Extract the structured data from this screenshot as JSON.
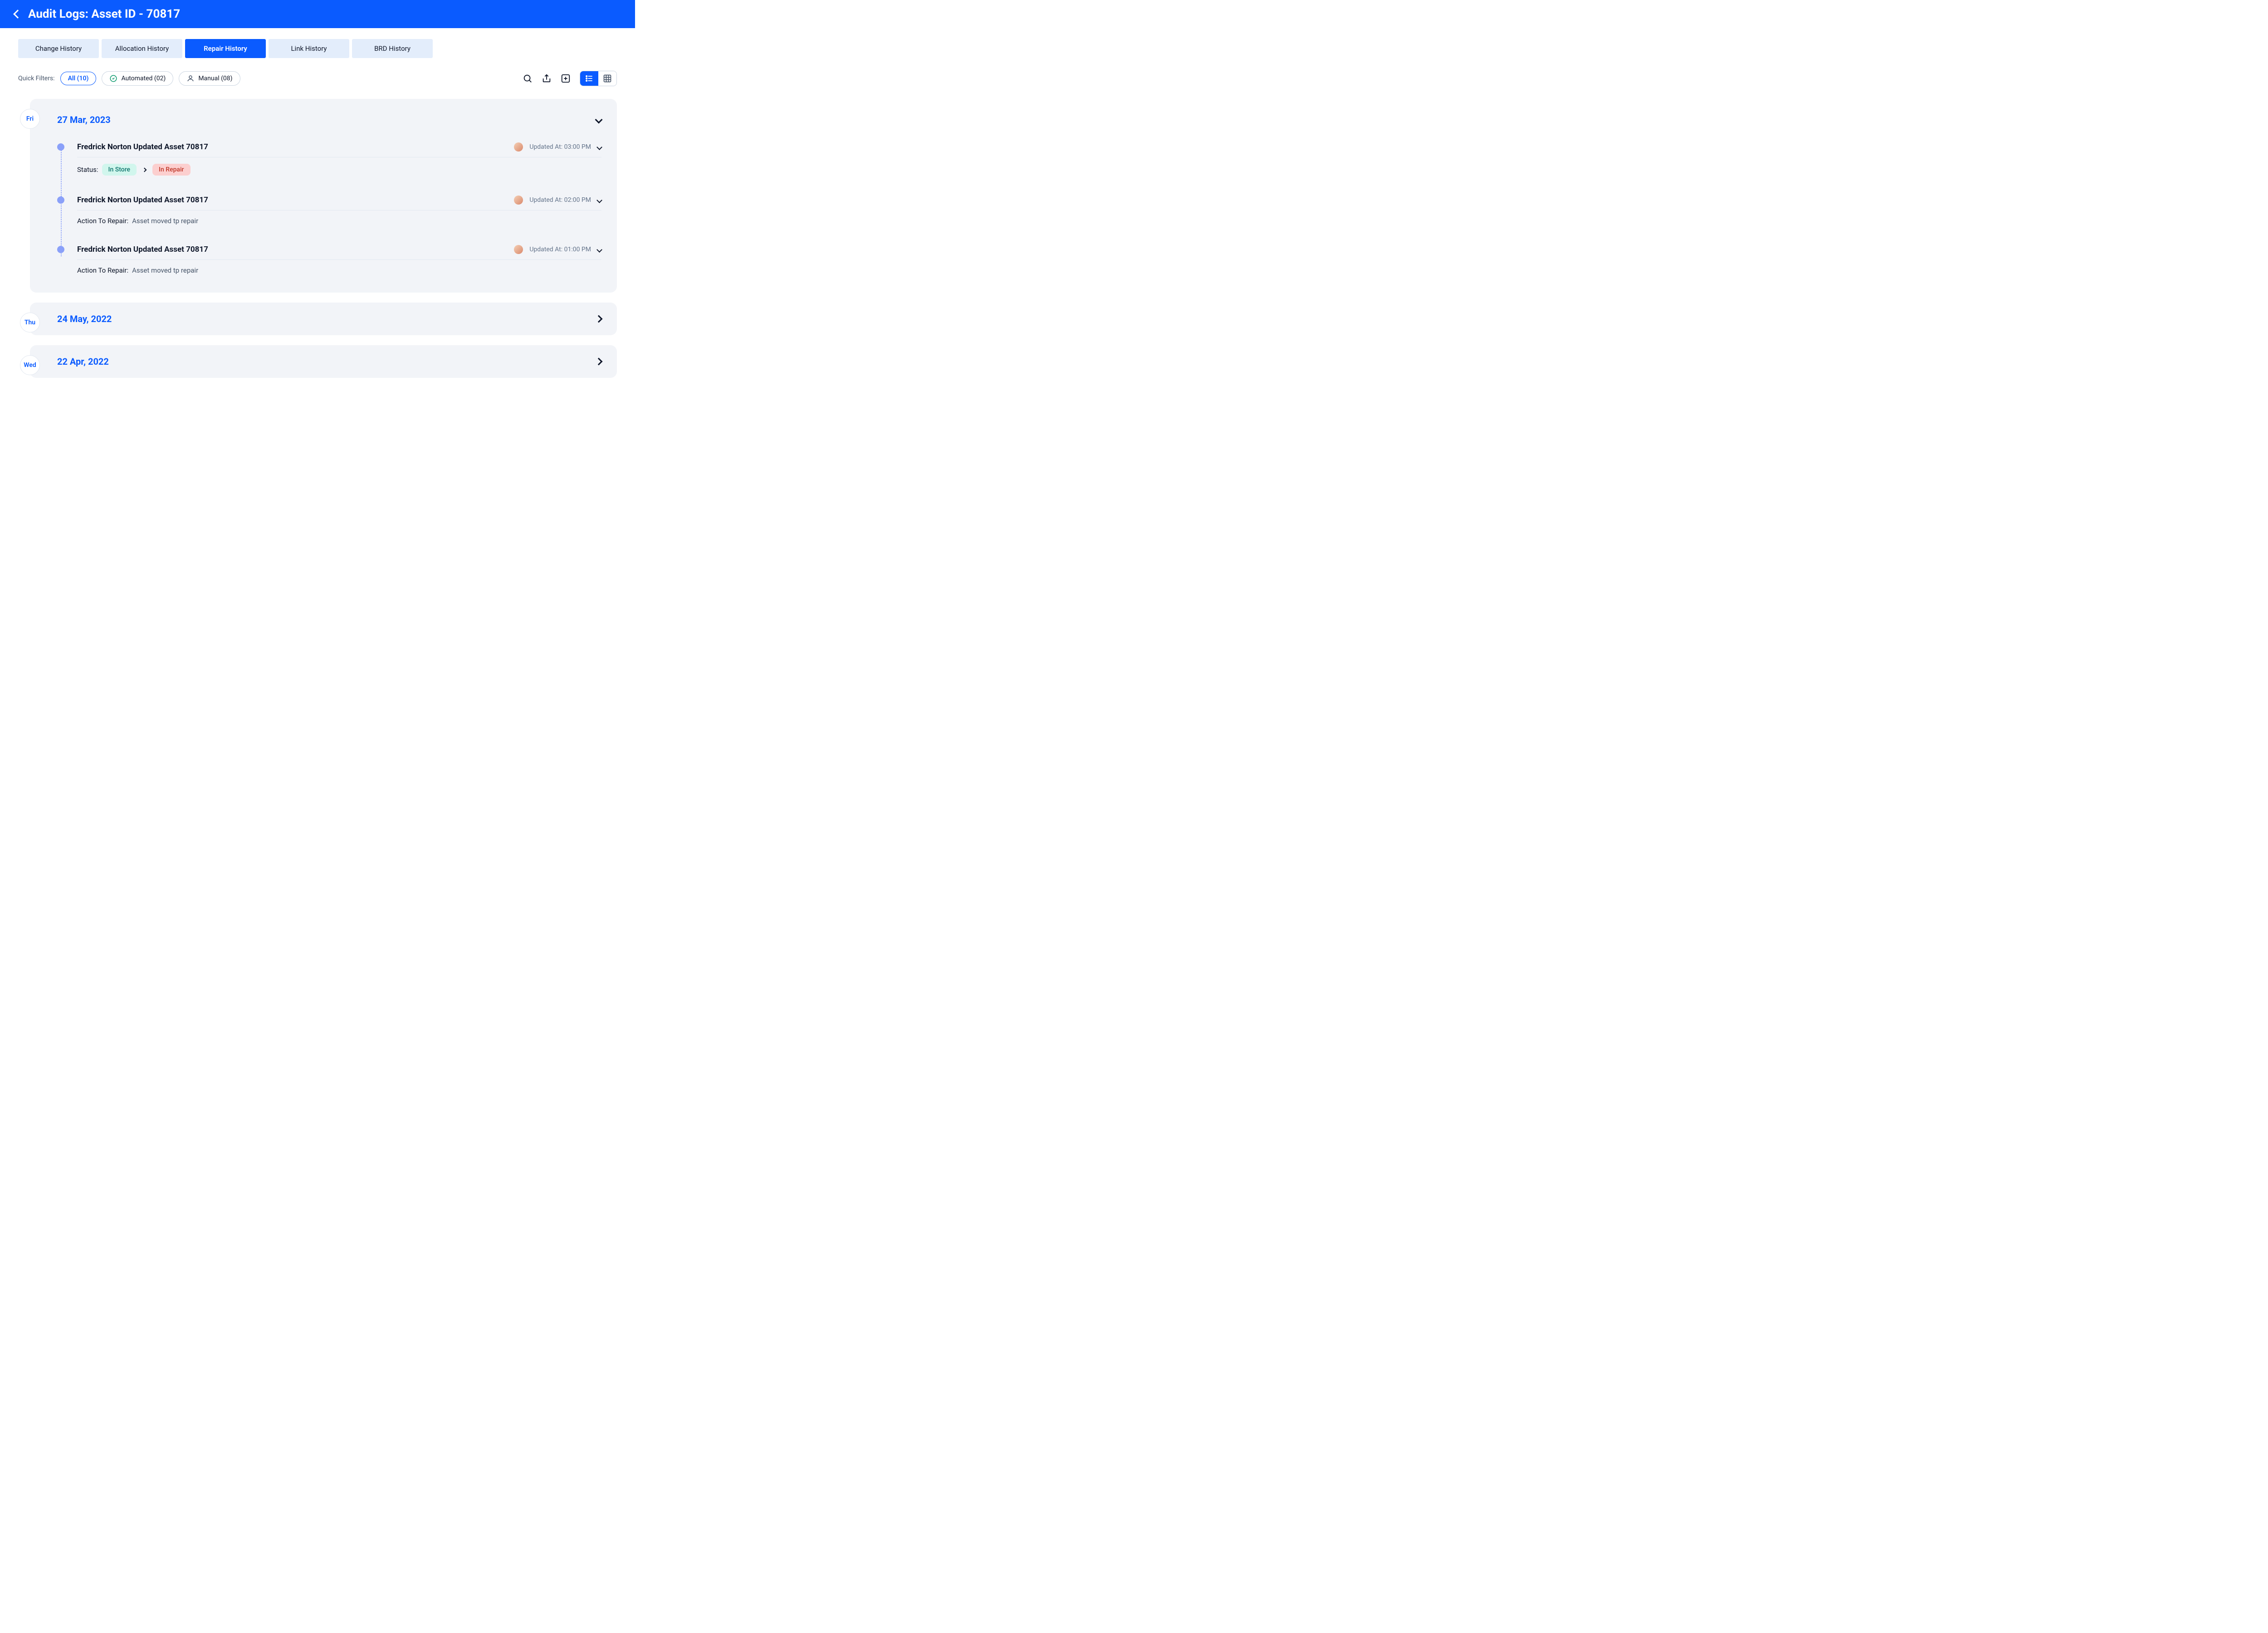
{
  "header": {
    "title": "Audit Logs:  Asset ID - 70817"
  },
  "tabs": [
    {
      "label": "Change History"
    },
    {
      "label": "Allocation History"
    },
    {
      "label": "Repair History"
    },
    {
      "label": "Link History"
    },
    {
      "label": "BRD History"
    }
  ],
  "filters": {
    "label": "Quick Filters:",
    "pills": [
      {
        "label": "All (10)"
      },
      {
        "label": "Automated (02)"
      },
      {
        "label": "Manual (08)"
      }
    ]
  },
  "days": [
    {
      "badge": "Fri",
      "date": "27 Mar, 2023",
      "events": [
        {
          "title": "Fredrick Norton Updated Asset 70817",
          "meta": "Updated At: 03:00 PM",
          "status_label": "Status:",
          "from_chip": "In Store",
          "to_chip": "In Repair"
        },
        {
          "title": "Fredrick Norton Updated Asset 70817",
          "meta": "Updated At: 02:00 PM",
          "action_label": "Action To Repair:",
          "action_value": "Asset moved tp repair"
        },
        {
          "title": "Fredrick Norton Updated Asset 70817",
          "meta": "Updated At: 01:00 PM",
          "action_label": "Action To Repair:",
          "action_value": "Asset moved tp repair"
        }
      ]
    },
    {
      "badge": "Thu",
      "date": "24  May, 2022"
    },
    {
      "badge": "Wed",
      "date": "22 Apr, 2022"
    }
  ]
}
